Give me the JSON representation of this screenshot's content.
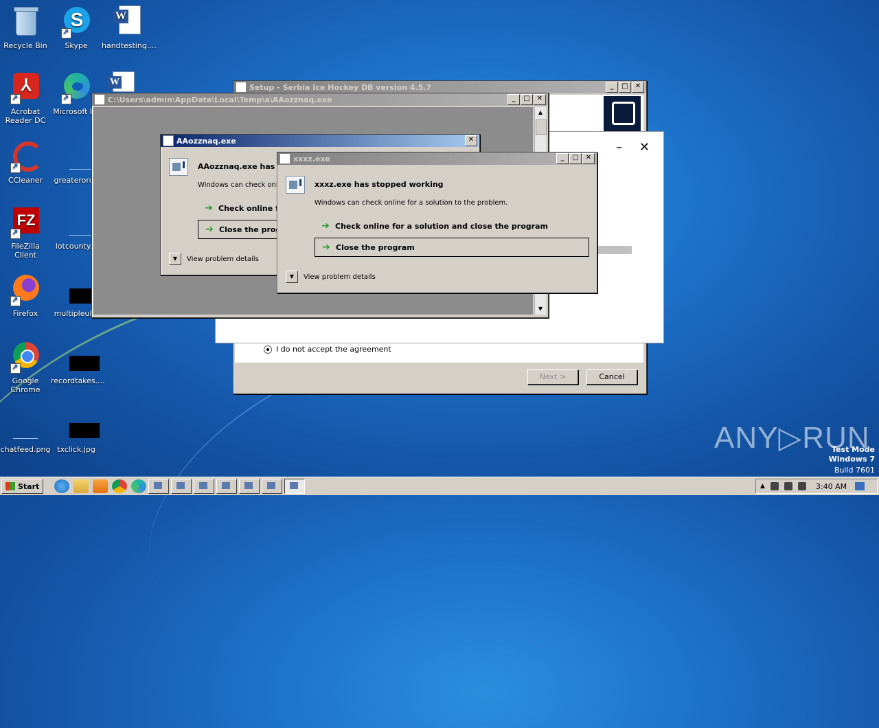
{
  "desktop": {
    "icons": [
      {
        "label": "Recycle Bin",
        "icon": "recycle-bin-icon"
      },
      {
        "label": "Skype",
        "icon": "skype-icon"
      },
      {
        "label": "handtesting....",
        "icon": "word-doc-icon"
      },
      {
        "label": "Acrobat Reader DC",
        "icon": "acrobat-icon"
      },
      {
        "label": "Microsoft Ed",
        "icon": "edge-icon"
      },
      {
        "label": "CCleaner",
        "icon": "ccleaner-icon"
      },
      {
        "label": "greaterorde",
        "icon": "file-icon"
      },
      {
        "label": "FileZilla Client",
        "icon": "filezilla-icon"
      },
      {
        "label": "lotcounty.p",
        "icon": "file-icon"
      },
      {
        "label": "Firefox",
        "icon": "firefox-icon"
      },
      {
        "label": "multipleuk.j",
        "icon": "file-icon"
      },
      {
        "label": "Google Chrome",
        "icon": "chrome-icon"
      },
      {
        "label": "recordtakes....",
        "icon": "file-icon"
      },
      {
        "label": "chatfeed.png",
        "icon": "file-icon"
      },
      {
        "label": "txclick.jpg",
        "icon": "file-icon"
      }
    ]
  },
  "setup_window": {
    "title": "Setup - Serbia Ice Hockey DB version 4.5.7",
    "radio_label": "I do not accept the agreement",
    "next_label": "Next >",
    "cancel_label": "Cancel"
  },
  "white_window": {
    "minimize": "–",
    "close": "✕"
  },
  "console_window": {
    "title": "C:\\Users\\admin\\AppData\\Local\\Temp\\a\\AAozznaq.exe"
  },
  "error_aa": {
    "title": "AAozznaq.exe",
    "heading": "AAozznaq.exe has st",
    "sub": "Windows can check onlin",
    "option1": "Check online for",
    "option2": "Close the progr",
    "details": "View problem details",
    "close": "✕"
  },
  "error_xx": {
    "title": "xxxz.exe",
    "heading": "xxxz.exe has stopped working",
    "sub": "Windows can check online for a solution to the problem.",
    "option1": "Check online for a solution and close the program",
    "option2": "Close the program",
    "details": "View problem details"
  },
  "taskbar": {
    "start_label": "Start",
    "clock": "3:40 AM"
  },
  "watermark": {
    "brand": "ANY▷RUN",
    "line1": "Test Mode",
    "line2": "Windows 7",
    "line3": "Build 7601"
  }
}
